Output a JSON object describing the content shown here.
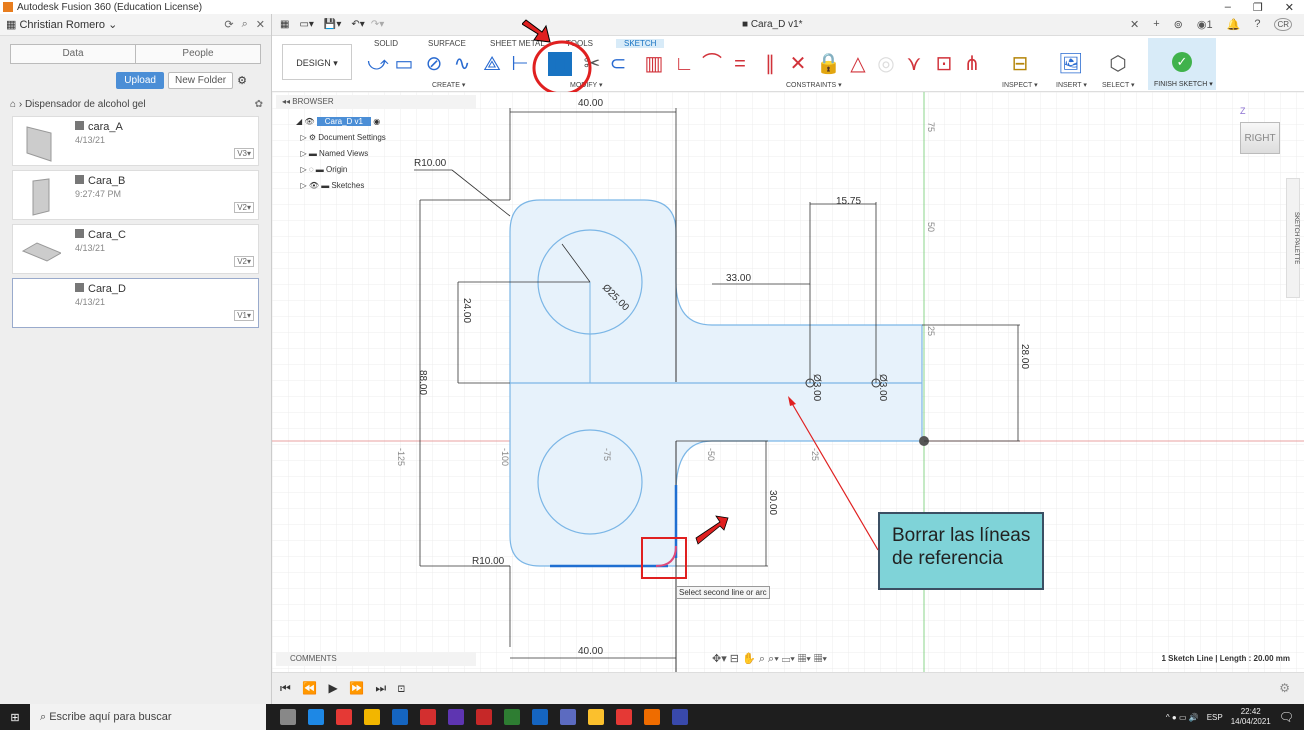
{
  "window": {
    "title": "Autodesk Fusion 360 (Education License)",
    "controls": [
      "–",
      "❐",
      "✕"
    ]
  },
  "data_panel": {
    "user": "Christian Romero",
    "tabs": [
      "Data",
      "People"
    ],
    "upload": "Upload",
    "new_folder": "New Folder",
    "project": "Dispensador de alcohol gel",
    "files": [
      {
        "name": "cara_A",
        "date": "4/13/21",
        "version": "V3▾"
      },
      {
        "name": "Cara_B",
        "date": "9:27:47 PM",
        "version": "V2▾"
      },
      {
        "name": "Cara_C",
        "date": "4/13/21",
        "version": "V2▾"
      },
      {
        "name": "Cara_D",
        "date": "4/13/21",
        "version": "V1▾"
      }
    ]
  },
  "document": {
    "title": "Cara_D v1*",
    "user_initials": "CR",
    "job_count": "1"
  },
  "ribbon": {
    "workspace": "DESIGN ▾",
    "tabs": [
      "SOLID",
      "SURFACE",
      "SHEET METAL",
      "TOOLS",
      "SKETCH"
    ],
    "groups": [
      "CREATE ▾",
      "MODIFY ▾",
      "CONSTRAINTS ▾",
      "INSPECT ▾",
      "INSERT ▾",
      "SELECT ▾"
    ],
    "finish": "FINISH SKETCH ▾"
  },
  "browser": {
    "header": "BROWSER",
    "items": [
      "Cara_D v1",
      "Document Settings",
      "Named Views",
      "Origin",
      "Sketches"
    ],
    "comments": "COMMENTS"
  },
  "sketch": {
    "dims": [
      "40.00",
      "R10.00",
      "15.75",
      "33.00",
      "24.00",
      "Ø25.00",
      "88.00",
      "Ø3.00",
      "Ø3.00",
      "28.00",
      "30.00",
      "R10.00",
      "40.00"
    ],
    "axis_labels": [
      "75",
      "50",
      "25",
      "-125",
      "-100",
      "-75",
      "-50",
      "-25"
    ]
  },
  "viewcube": {
    "face": "RIGHT",
    "axis": "Z"
  },
  "palette": "SKETCH PALETTE",
  "tooltip": "Select second line or arc",
  "callout": "Borrar las líneas de referencia",
  "status": "1 Sketch Line | Length : 20.00 mm",
  "taskbar": {
    "search": "Escribe aquí para buscar",
    "lang": "ESP",
    "time": "22:42",
    "date": "14/04/2021"
  }
}
